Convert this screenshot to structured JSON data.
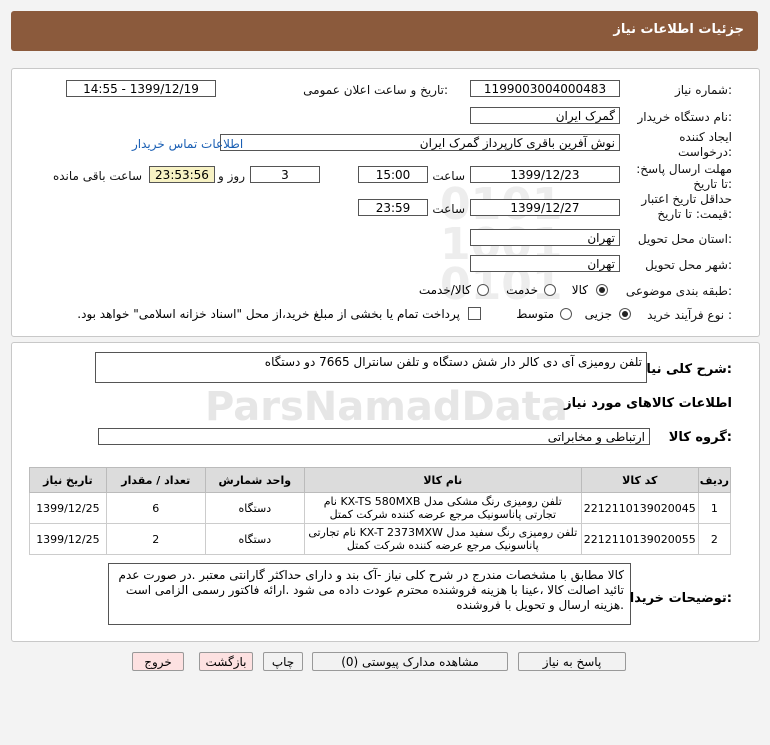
{
  "header": {
    "title": "جزئیات اطلاعات نیاز"
  },
  "form": {
    "need_number_label": "شماره نیاز:",
    "need_number": "1199003004000483",
    "announce_label": "تاریخ و ساعت اعلان عمومی:",
    "announce_value": "1399/12/19 - 14:55",
    "buyer_org_label": "نام دستگاه خریدار:",
    "buyer_org": "گمرک ایران",
    "creator_label": "ایجاد کننده درخواست:",
    "creator": "نوش آفرین باقری کارپرداز گمرک ایران",
    "contact_link": "اطلاعات تماس خریدار",
    "deadline_label": "مهلت ارسال پاسخ: تا تاریخ:",
    "deadline_date": "1399/12/23",
    "time_label": "ساعت",
    "deadline_time": "15:00",
    "days_value": "3",
    "days_label": "روز و",
    "remaining_time": "23:53:56",
    "remaining_label": "ساعت باقی مانده",
    "validity_label": "حداقل تاریخ اعتبار قیمت: تا تاریخ:",
    "validity_date": "1399/12/27",
    "validity_time_label": "ساعت",
    "validity_time": "23:59",
    "province_label": "استان محل تحویل:",
    "province": "تهران",
    "city_label": "شهر محل تحویل:",
    "city": "تهران",
    "category_label": "طبقه بندی موضوعی:",
    "category_options": [
      "کالا",
      "خدمت",
      "کالا/خدمت"
    ],
    "process_label": "نوع فرآیند خرید :",
    "process_options": [
      "جزیی",
      "متوسط"
    ],
    "payment_note": "پرداخت تمام یا بخشی از مبلغ خرید،از محل \"اسناد خزانه اسلامی\" خواهد بود."
  },
  "description": {
    "label": "شرح کلی نیاز:",
    "text": "تلفن رومیزی آی دی کالر دار شش دستگاه و تلفن سانترال 7665 دو دستگاه"
  },
  "goods": {
    "heading": "اطلاعات کالاهای مورد نیاز",
    "group_label": "گروه کالا:",
    "group_value": "ارتباطی و مخابراتی",
    "columns": [
      "ردیف",
      "کد کالا",
      "نام کالا",
      "واحد شمارش",
      "تعداد / مقدار",
      "تاریخ نیاز"
    ],
    "rows": [
      {
        "idx": "1",
        "code": "2212110139020045",
        "name": "تلفن رومیزی رنگ مشکی مدل KX-TS 580MXB نام تجارتی پاناسونیک مرجع عرضه کننده شرکت کمتل",
        "unit": "دستگاه",
        "qty": "6",
        "date": "1399/12/25"
      },
      {
        "idx": "2",
        "code": "2212110139020055",
        "name": "تلفن رومیزی رنگ سفید مدل KX-T 2373MXW نام تجارتی پاناسونیک مرجع عرضه کننده شرکت کمتل",
        "unit": "دستگاه",
        "qty": "2",
        "date": "1399/12/25"
      }
    ]
  },
  "buyer_notes": {
    "label": "توضیحات خریدار:",
    "text": "کالا مطابق با مشخصات مندرج در شرح کلی نیاز -آک بند و دارای حداکثر گارانتی معتبر .در صورت عدم تائید اصالت کالا ،عینا با هزینه فروشنده محترم عودت داده می شود .ارائه فاکتور رسمی الزامی است .هزینه ارسال و تحویل با فروشنده"
  },
  "buttons": {
    "reply": "پاسخ به نیاز",
    "attachments": "مشاهده مدارک پیوستی (0)",
    "print": "چاپ",
    "back": "بازگشت",
    "exit": "خروج"
  },
  "watermark": {
    "text": "ParsNamadData"
  },
  "colors": {
    "header": "#8b5a3c",
    "link": "#1a5fb4",
    "remaining_bg": "#f7f2c4"
  }
}
